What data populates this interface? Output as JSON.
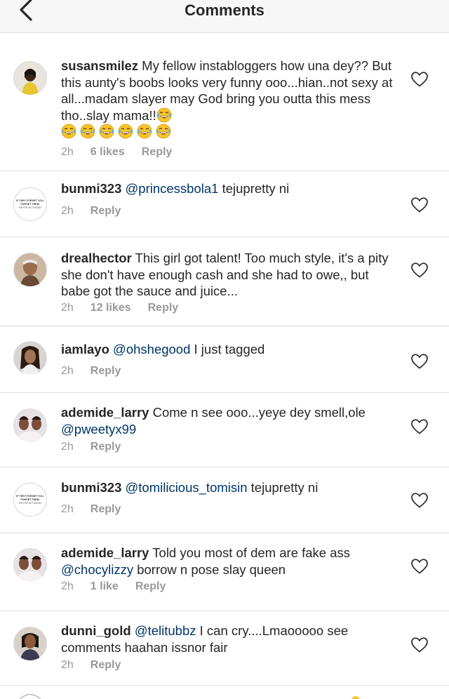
{
  "header": {
    "title": "Comments",
    "back_icon": "chevron-left-icon"
  },
  "comments": [
    {
      "username": "susansmilez",
      "text": "My fellow instabloggers how una dey?? But this aunty's boobs looks very funny ooo...hian..not sexy at all...madam slayer may God bring you outta this mess tho..slay mama!!",
      "emoji_count": 7,
      "emoji_icon": "tears-of-joy-emoji",
      "time": "2h",
      "likes": "6 likes",
      "reply": "Reply"
    },
    {
      "username": "bunmi323",
      "mention": "@princessbola1",
      "text": "tejupretty ni",
      "avatar_text": [
        "IF THEY FORGET YOU,",
        "FORGET THEM.",
        "THEY'RE NOT MONEY"
      ],
      "time": "2h",
      "reply": "Reply"
    },
    {
      "username": "drealhector",
      "text": "This girl got talent! Too much style, it's a pity she don't have enough cash and she had to owe,, but babe got the sauce and juice...",
      "time": "2h",
      "likes": "12 likes",
      "reply": "Reply"
    },
    {
      "username": "iamlayo",
      "mention": "@ohshegood",
      "text": "I just tagged",
      "time": "2h",
      "reply": "Reply"
    },
    {
      "username": "ademide_larry",
      "text": "Come n see ooo...yeye dey smell,ole",
      "mention": "@pweetyx99",
      "time": "2h",
      "reply": "Reply"
    },
    {
      "username": "bunmi323",
      "mention": "@tomilicious_tomisin",
      "text": "tejupretty ni",
      "avatar_text": [
        "IF THEY FORGET YOU,",
        "FORGET THEM.",
        "THEY'RE NOT MONEY"
      ],
      "time": "2h",
      "reply": "Reply"
    },
    {
      "username": "ademide_larry",
      "text": "Told you most of dem are fake ass",
      "mention": "@chocylizzy",
      "text2": "borrow n pose slay queen",
      "time": "2h",
      "likes": "1 like",
      "reply": "Reply"
    },
    {
      "username": "dunni_gold",
      "mention": "@telitubbz",
      "text": "I can cry....Lmaooooo see comments haahan issnor fair",
      "time": "2h",
      "reply": "Reply"
    }
  ],
  "colors": {
    "mention": "#003569",
    "meta": "#999999",
    "divider": "#dbdbdb",
    "header_bg": "#f7f7f7"
  }
}
